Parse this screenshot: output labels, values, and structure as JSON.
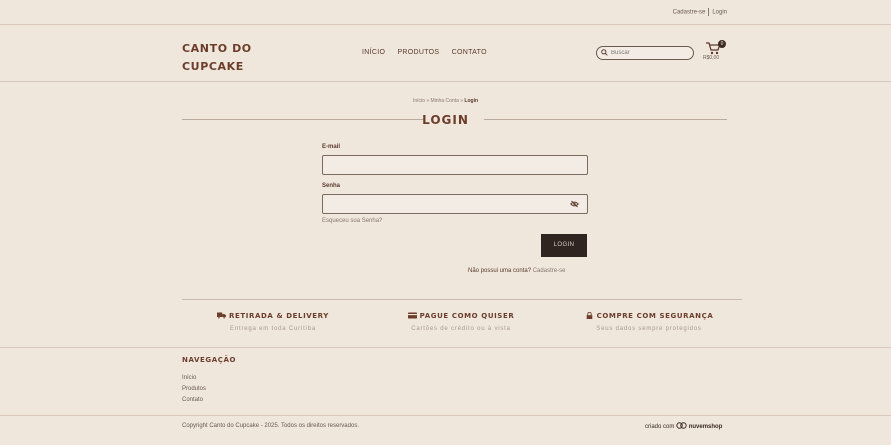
{
  "top_links": {
    "register": "Cadastre-se",
    "login": "Login"
  },
  "brand": {
    "line1": "CANTO DO",
    "line2": "CUPCAKE"
  },
  "nav": [
    "INÍCIO",
    "PRODUTOS",
    "CONTATO"
  ],
  "search": {
    "placeholder": "Buscar"
  },
  "cart": {
    "count": "0",
    "total": "R$0,00"
  },
  "breadcrumb": {
    "path": "Início » Minha Conta » ",
    "current": "Login"
  },
  "page_title": "LOGIN",
  "form": {
    "email_label": "E-mail",
    "password_label": "Senha",
    "forgot": "Esqueceu sua Senha?",
    "submit": "LOGIN",
    "no_account": "Não possui uma conta?",
    "register_link": "Cadastre-se"
  },
  "features": [
    {
      "title": "RETIRADA & DELIVERY",
      "subtitle": "Entrega em toda Curitiba",
      "icon": "truck-icon"
    },
    {
      "title": "PAGUE COMO QUISER",
      "subtitle": "Cartões de crédito ou à vista",
      "icon": "card-icon"
    },
    {
      "title": "COMPRE COM SEGURANÇA",
      "subtitle": "Seus dados sempre protegidos",
      "icon": "lock-icon"
    }
  ],
  "footer": {
    "nav_heading": "NAVEGAÇÃO",
    "links": [
      "Início",
      "Produtos",
      "Contato"
    ],
    "copyright": "Copyright Canto do Cupcake - 2025. Todos os direitos reservados.",
    "credit_prefix": "criado com",
    "credit_brand": "nuvemshop"
  },
  "colors": {
    "background": "#efe6dc",
    "brand": "#6b3d2a",
    "button": "#2f2420"
  }
}
